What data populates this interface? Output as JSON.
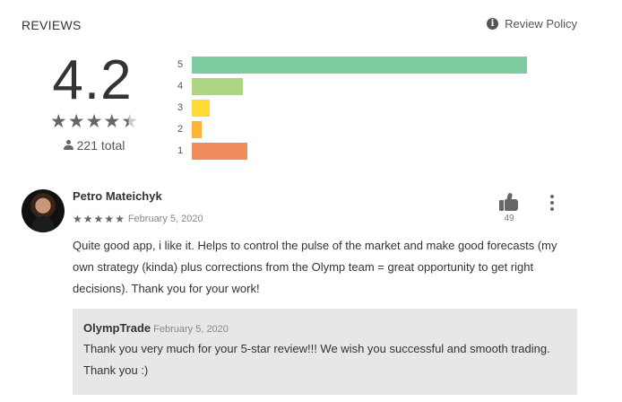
{
  "header": {
    "title": "REVIEWS",
    "policy_label": "Review Policy",
    "policy_icon": "info-icon"
  },
  "summary": {
    "rating": "4.2",
    "star_fill": 4.2,
    "total_label": "221 total"
  },
  "histogram": [
    {
      "label": "5",
      "fraction": 0.85,
      "color": "#7dcba0"
    },
    {
      "label": "4",
      "fraction": 0.13,
      "color": "#aed582"
    },
    {
      "label": "3",
      "fraction": 0.045,
      "color": "#ffd935"
    },
    {
      "label": "2",
      "fraction": 0.025,
      "color": "#ffb235"
    },
    {
      "label": "1",
      "fraction": 0.14,
      "color": "#f08b5d"
    }
  ],
  "review": {
    "author": "Petro Mateichyk",
    "stars": 5,
    "date": "February 5, 2020",
    "text": "Quite good app, i like it. Helps to control the pulse of the market and make good forecasts (my own strategy (kinda) plus corrections from the Olymp team = great opportunity to get right decisions). Thank you for your work!",
    "helpful_count": "49"
  },
  "reply": {
    "author": "OlympTrade",
    "date": "February 5, 2020",
    "text": "Thank you very much for your 5-star review!!! We wish you successful and smooth trading. Thank you :)"
  }
}
